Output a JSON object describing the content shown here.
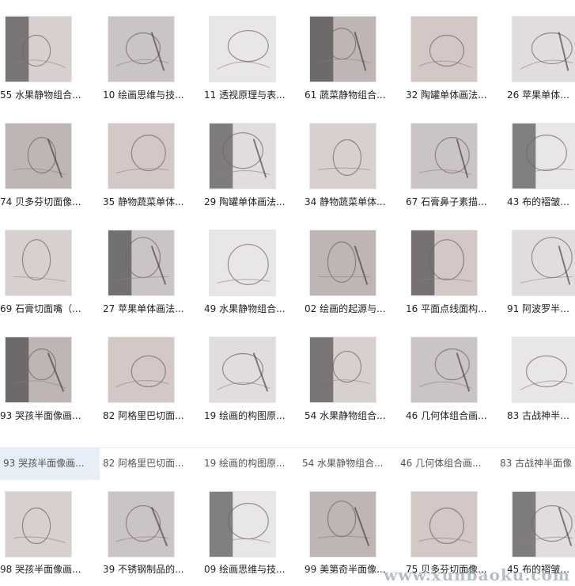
{
  "grid": {
    "rows": [
      [
        "55 水果静物组合...",
        "10 绘画思维与技...",
        "11 透视原理与表...",
        "61 蔬菜静物组合...",
        "32 陶罐单体画法...",
        "26 苹果单体画法"
      ],
      [
        "74 贝多芬切面像...",
        "35 静物蔬菜单体...",
        "29 陶罐单体画法...",
        "34 静物蔬菜单体...",
        "67 石膏鼻子素描...",
        "43 布的褶皱画法"
      ],
      [
        "69 石膏切面嘴（...",
        "27 苹果单体画法...",
        "49 水果静物组合...",
        "02 绘画的起源与...",
        "16 平面点线面构...",
        "91 阿波罗半面像"
      ],
      [
        "93 哭孩半面像画...",
        "82 阿格里巴切面...",
        "19 绘画的构图原...",
        "54 水果静物组合...",
        "46 几何体组合画...",
        "83 古战神半面像"
      ],
      [
        "98 哭孩半面像画...",
        "39 不锈钢制品的...",
        "09 绘画思维与技...",
        "99 美第奇半面像...",
        "75 贝多芬切面像...",
        "45 布的褶皱画法"
      ]
    ]
  },
  "selection_strip": [
    "93 哭孩半面像画...",
    "82 阿格里巴切面...",
    "19 绘画的构图原...",
    "54 水果静物组合...",
    "46 几何体组合画...",
    "83 古战神半面像"
  ],
  "watermark": "www.xunbaoku.com"
}
